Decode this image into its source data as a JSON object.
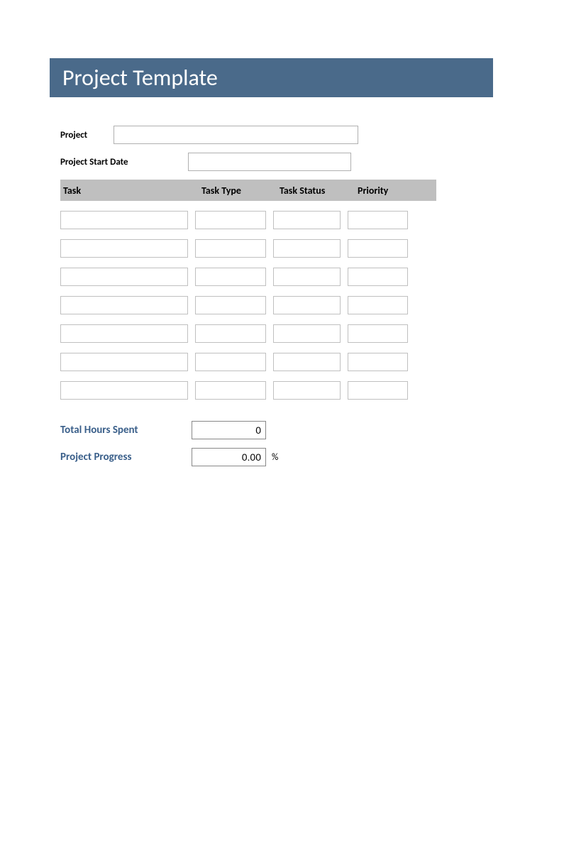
{
  "title": "Project Template",
  "fields": {
    "project_label": "Project",
    "project_value": "",
    "start_date_label": "Project Start Date",
    "start_date_value": ""
  },
  "table": {
    "headers": {
      "task": "Task",
      "task_type": "Task Type",
      "task_status": "Task Status",
      "priority": "Priority"
    },
    "rows": [
      {
        "task": "",
        "type": "",
        "status": "",
        "priority": ""
      },
      {
        "task": "",
        "type": "",
        "status": "",
        "priority": ""
      },
      {
        "task": "",
        "type": "",
        "status": "",
        "priority": ""
      },
      {
        "task": "",
        "type": "",
        "status": "",
        "priority": ""
      },
      {
        "task": "",
        "type": "",
        "status": "",
        "priority": ""
      },
      {
        "task": "",
        "type": "",
        "status": "",
        "priority": ""
      },
      {
        "task": "",
        "type": "",
        "status": "",
        "priority": ""
      }
    ]
  },
  "summary": {
    "hours_label": "Total Hours Spent",
    "hours_value": "0",
    "progress_label": "Project Progress",
    "progress_value": "0.00",
    "progress_unit": "%"
  }
}
